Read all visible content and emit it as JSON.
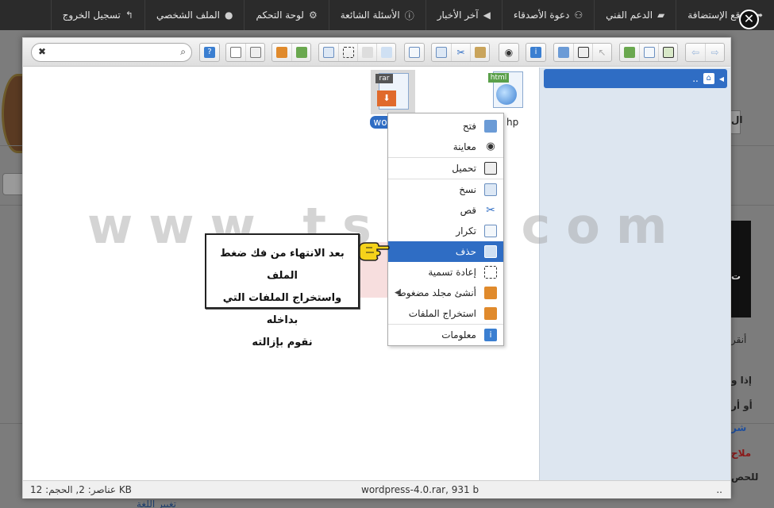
{
  "topbar": {
    "items": [
      {
        "label": "موقع الإستضافة",
        "icon": "share-arrow-icon"
      },
      {
        "label": "الدعم الفني",
        "icon": "chat-icon"
      },
      {
        "label": "دعوة الأصدقاء",
        "icon": "users-icon"
      },
      {
        "label": "آخر الأخبار",
        "icon": "megaphone-icon"
      },
      {
        "label": "الأسئلة الشائعة",
        "icon": "info-icon"
      },
      {
        "label": "لوحة التحكم",
        "icon": "gear-icon"
      },
      {
        "label": "الملف الشخصي",
        "icon": "user-icon"
      },
      {
        "label": "تسجيل الخروج",
        "icon": "logout-arrow-icon"
      }
    ]
  },
  "dialog": {
    "close_label": "✕",
    "search_placeholder": ""
  },
  "files": [
    {
      "name": "hp",
      "type": "html"
    },
    {
      "name": "wordpre",
      "type": "rar",
      "selected": true
    }
  ],
  "tree": {
    "root_label": ".."
  },
  "statusbar": {
    "left": "عناصر: 2, الحجم: 12 KB",
    "center": "wordpress-4.0.rar, 931 b",
    "right": ".."
  },
  "context_menu": {
    "items": [
      {
        "label": "فتح",
        "icon": "open-icon"
      },
      {
        "label": "معاينة",
        "icon": "eye-icon"
      },
      {
        "sep": true
      },
      {
        "label": "تحميل",
        "icon": "save-icon"
      },
      {
        "sep": true
      },
      {
        "label": "نسخ",
        "icon": "copy-icon"
      },
      {
        "label": "قص",
        "icon": "scissors-icon"
      },
      {
        "label": "تكرار",
        "icon": "duplicate-icon"
      },
      {
        "label": "حذف",
        "icon": "trash-icon",
        "active": true
      },
      {
        "label": "إعادة تسمية",
        "icon": "rename-icon"
      },
      {
        "label": "أنشئ مجلد مضغوط",
        "icon": "archive-icon",
        "submenu": true
      },
      {
        "label": "استخراج الملفات",
        "icon": "extract-icon"
      },
      {
        "sep": true
      },
      {
        "label": "معلومات",
        "icon": "info-icon"
      }
    ]
  },
  "note": {
    "line1": "بعد الانتهاء من فك ضغط الملف",
    "line2": "واستخراج الملفات التي بداخله",
    "line3": "نقوم بإزالته"
  },
  "watermark": "www.ts3a.com",
  "background": {
    "right_text_1": "ال",
    "right_text_2": "أنقر",
    "right_text_3": "إذا و",
    "right_text_4": "أو أر",
    "right_text_5": "شر",
    "right_text_6": "ملاح",
    "right_text_7": "للحص",
    "right_text_8": "ت",
    "bottom_link": "تغيير اللغة"
  }
}
